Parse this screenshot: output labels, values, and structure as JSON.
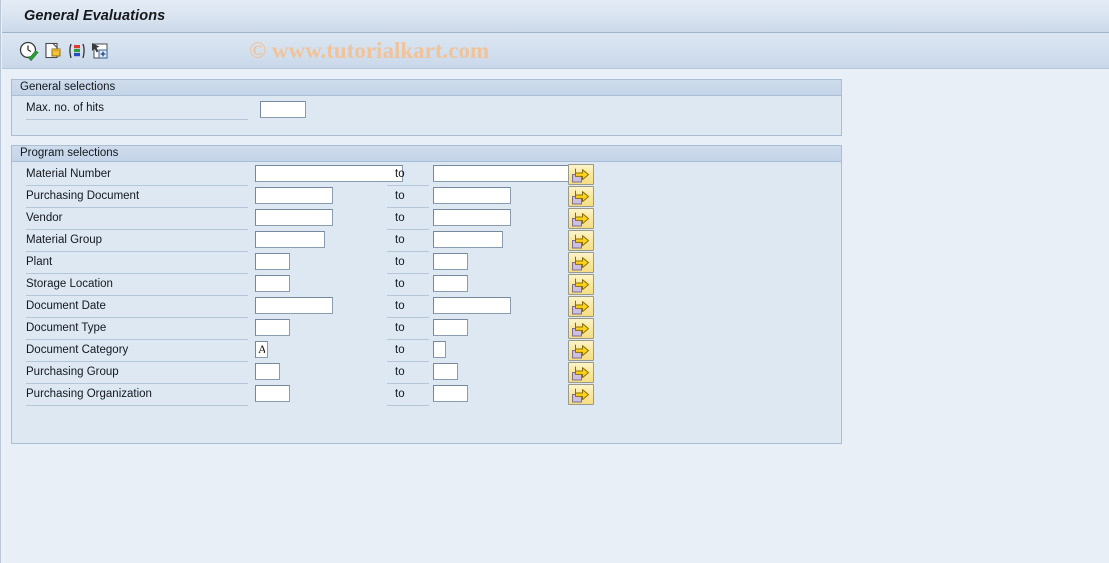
{
  "window": {
    "title": "General Evaluations"
  },
  "watermark": {
    "text": "© www.tutorialkart.com",
    "color": "#f0c39b"
  },
  "toolbar": {
    "buttons": [
      {
        "name": "execute-icon",
        "label": "Execute",
        "x": 16
      },
      {
        "name": "get-variant-icon",
        "label": "Get Variant",
        "x": 41
      },
      {
        "name": "multiple-selection-icon",
        "label": "Selection Options",
        "x": 64
      },
      {
        "name": "selection-screen-icon",
        "label": "Dynamic Selections",
        "x": 87
      }
    ]
  },
  "general_selections": {
    "header": "General selections",
    "max_hits": {
      "label": "Max. no. of hits",
      "value": "",
      "placeholder": ""
    }
  },
  "program_selections": {
    "header": "Program selections",
    "to_label": "to",
    "rows": [
      {
        "label": "Material Number",
        "from_value": "",
        "to_value": "",
        "from_width": 148,
        "to_width": 136,
        "label_rule_width": 222
      },
      {
        "label": "Purchasing Document",
        "from_value": "",
        "to_value": "",
        "from_width": 78,
        "to_width": 78,
        "label_rule_width": 222
      },
      {
        "label": "Vendor",
        "from_value": "",
        "to_value": "",
        "from_width": 78,
        "to_width": 78,
        "label_rule_width": 222
      },
      {
        "label": "Material Group",
        "from_value": "",
        "to_value": "",
        "from_width": 70,
        "to_width": 70,
        "label_rule_width": 222
      },
      {
        "label": "Plant",
        "from_value": "",
        "to_value": "",
        "from_width": 35,
        "to_width": 35,
        "label_rule_width": 222
      },
      {
        "label": "Storage Location",
        "from_value": "",
        "to_value": "",
        "from_width": 35,
        "to_width": 35,
        "label_rule_width": 222
      },
      {
        "label": "Document Date",
        "from_value": "",
        "to_value": "",
        "from_width": 78,
        "to_width": 78,
        "label_rule_width": 222
      },
      {
        "label": "Document Type",
        "from_value": "",
        "to_value": "",
        "from_width": 35,
        "to_width": 35,
        "label_rule_width": 222
      },
      {
        "label": "Document Category",
        "from_value": "A",
        "to_value": "",
        "from_width": 13,
        "to_width": 13,
        "label_rule_width": 222
      },
      {
        "label": "Purchasing Group",
        "from_value": "",
        "to_value": "",
        "from_width": 25,
        "to_width": 25,
        "label_rule_width": 222
      },
      {
        "label": "Purchasing Organization",
        "from_value": "",
        "to_value": "",
        "from_width": 35,
        "to_width": 35,
        "label_rule_width": 222
      }
    ],
    "select_button_title": "Multiple selection"
  },
  "colors": {
    "page_background": "#e9eff7",
    "panel_background": "#dde8f3",
    "panel_border": "#a9bdd4",
    "title_bar": "#d8e3f0",
    "button_yellow": "#f7e79c",
    "arrow_gold": "#f5c518"
  }
}
